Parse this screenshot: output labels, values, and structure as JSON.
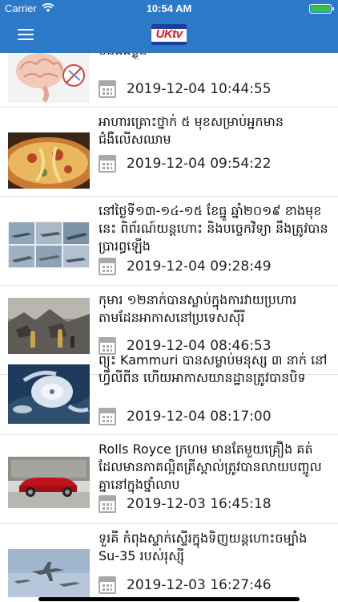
{
  "status": {
    "carrier": "Carrier",
    "time": "10:54 AM"
  },
  "header": {
    "logo_text": "UKtv"
  },
  "articles": [
    {
      "title": "ព្រមាន មួយចំនួនដែលអាចសម្លាប់មនុស្ស ដោយមិនដឹងខ្លួន",
      "date": "2019-12-04 10:44:55"
    },
    {
      "title": "អាហារគ្រោះថ្នាក់ ៥ មុខសម្រាប់អ្នកមានជំងឺលើសឈាម",
      "date": "2019-12-04 09:54:22"
    },
    {
      "title": "នៅថ្ងៃទី១៣-១៤-១៥ ខែធ្នូ ឆ្នាំ២០១៩ ខាងមុខនេះ ពិព័រណ៍យន្តហោះ និងបច្ចេកវិទ្យា នឹងត្រូវបានប្រារព្ធឡើង",
      "date": "2019-12-04 09:28:49"
    },
    {
      "title": "កុមារ ១២នាក់បានស្លាប់ក្នុងការវាយប្រហារតាមដែនអាកាសនៅប្រទេសស៊ីរី",
      "date": "2019-12-04 08:46:53"
    },
    {
      "title": "ព្យុះ Kammuri បានសម្លាប់មនុស្ស ៣ នាក់ នៅហ្វីលីពីន ហើយអាកាសយានដ្ឋានត្រូវបានបិទ",
      "date": "2019-12-04 08:17:00"
    },
    {
      "title": "Rolls Royce ក្រហម មានតែមួយគ្រឿង គត់ ដែលមានភាគល្អិតគ្រីស្តាល់ត្រូវបានលាយបញ្ចូលគ្នានៅក្នុងថ្នាំលាប",
      "date": "2019-12-03 16:45:18"
    },
    {
      "title": "ទួរគី កំពុងស្ទាក់ស្ទើរក្នុងទិញយន្តហោះចម្បាំង Su-35 របស់រុស្ស៊ី",
      "date": "2019-12-03 16:27:46"
    }
  ]
}
